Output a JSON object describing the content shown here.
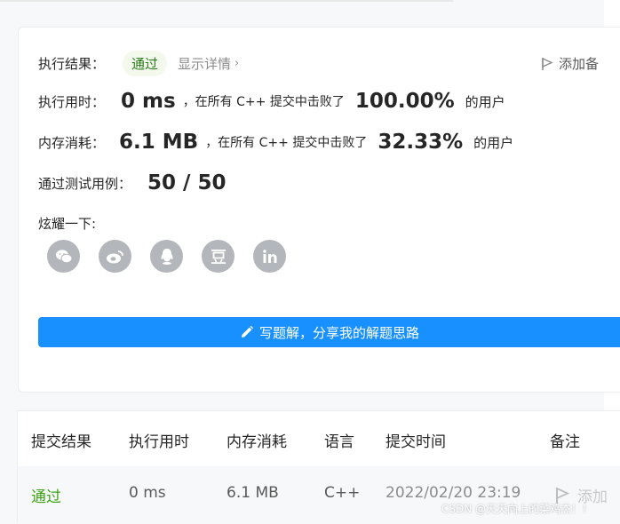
{
  "result": {
    "label": "执行结果：",
    "status": "通过",
    "detail_link": "显示详情",
    "add_note": "添加备"
  },
  "runtime": {
    "label": "执行用时：",
    "value": "0 ms",
    "mid": "，在所有 C++ 提交中击败了",
    "percent": "100.00%",
    "suffix": "的用户"
  },
  "memory": {
    "label": "内存消耗：",
    "value": "6.1 MB",
    "mid": "，在所有 C++ 提交中击败了",
    "percent": "32.33%",
    "suffix": "的用户"
  },
  "tests": {
    "label": "通过测试用例：",
    "value": "50 / 50"
  },
  "share": {
    "label": "炫耀一下:",
    "icons": [
      "wechat-icon",
      "weibo-icon",
      "qq-icon",
      "douban-icon",
      "linkedin-icon"
    ]
  },
  "cta": {
    "label": "写题解，分享我的解题思路"
  },
  "table": {
    "headers": [
      "提交结果",
      "执行用时",
      "内存消耗",
      "语言",
      "提交时间",
      "备注"
    ],
    "row": {
      "result": "通过",
      "runtime": "0 ms",
      "memory": "6.1 MB",
      "language": "C++",
      "time": "2022/02/20 23:19",
      "note": "添加"
    }
  },
  "watermark": "CSDN @天天向上的菜鸡杰！！",
  "colors": {
    "accent": "#1890ff",
    "pass_green": "#3fa317",
    "pill_bg": "#f3faed"
  }
}
